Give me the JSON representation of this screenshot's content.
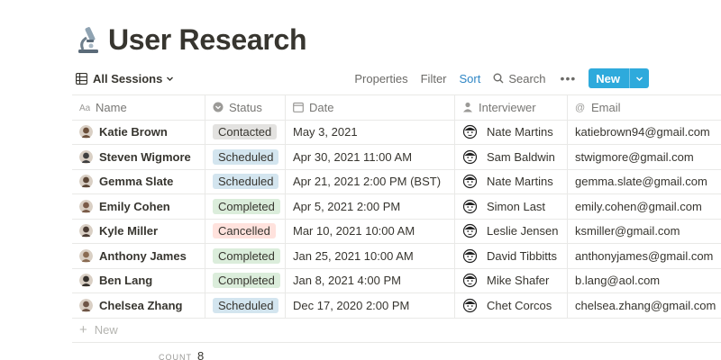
{
  "page": {
    "title": "User Research",
    "title_icon": "microscope-icon"
  },
  "toolbar": {
    "view_label": "All Sessions",
    "properties": "Properties",
    "filter": "Filter",
    "sort": "Sort",
    "search": "Search",
    "more": "•••",
    "new": "New"
  },
  "columns": {
    "name": "Name",
    "status": "Status",
    "date": "Date",
    "interviewer": "Interviewer",
    "email": "Email"
  },
  "status_colors": {
    "Contacted": "#e3e2e0",
    "Scheduled": "#d3e5ef",
    "Completed": "#dbeddb",
    "Cancelled": "#ffe2dd"
  },
  "rows": [
    {
      "name": "Katie Brown",
      "status": "Contacted",
      "date": "May 3, 2021",
      "interviewer": "Nate Martins",
      "email": "katiebrown94@gmail.com"
    },
    {
      "name": "Steven Wigmore",
      "status": "Scheduled",
      "date": "Apr 30, 2021 11:00 AM",
      "interviewer": "Sam Baldwin",
      "email": "stwigmore@gmail.com"
    },
    {
      "name": "Gemma Slate",
      "status": "Scheduled",
      "date": "Apr 21, 2021 2:00 PM (BST)",
      "interviewer": "Nate Martins",
      "email": "gemma.slate@gmail.com"
    },
    {
      "name": "Emily Cohen",
      "status": "Completed",
      "date": "Apr 5, 2021 2:00 PM",
      "interviewer": "Simon Last",
      "email": "emily.cohen@gmail.com"
    },
    {
      "name": "Kyle Miller",
      "status": "Cancelled",
      "date": "Mar 10, 2021 10:00 AM",
      "interviewer": "Leslie Jensen",
      "email": "ksmiller@gmail.com"
    },
    {
      "name": "Anthony James",
      "status": "Completed",
      "date": "Jan 25, 2021 10:00 AM",
      "interviewer": "David Tibbitts",
      "email": "anthonyjames@gmail.com"
    },
    {
      "name": "Ben Lang",
      "status": "Completed",
      "date": "Jan 8, 2021 4:00 PM",
      "interviewer": "Mike Shafer",
      "email": "b.lang@aol.com"
    },
    {
      "name": "Chelsea Zhang",
      "status": "Scheduled",
      "date": "Dec 17, 2020 2:00 PM",
      "interviewer": "Chet Corcos",
      "email": "chelsea.zhang@gmail.com"
    }
  ],
  "new_row_label": "New",
  "count": {
    "label": "COUNT",
    "value": "8"
  }
}
